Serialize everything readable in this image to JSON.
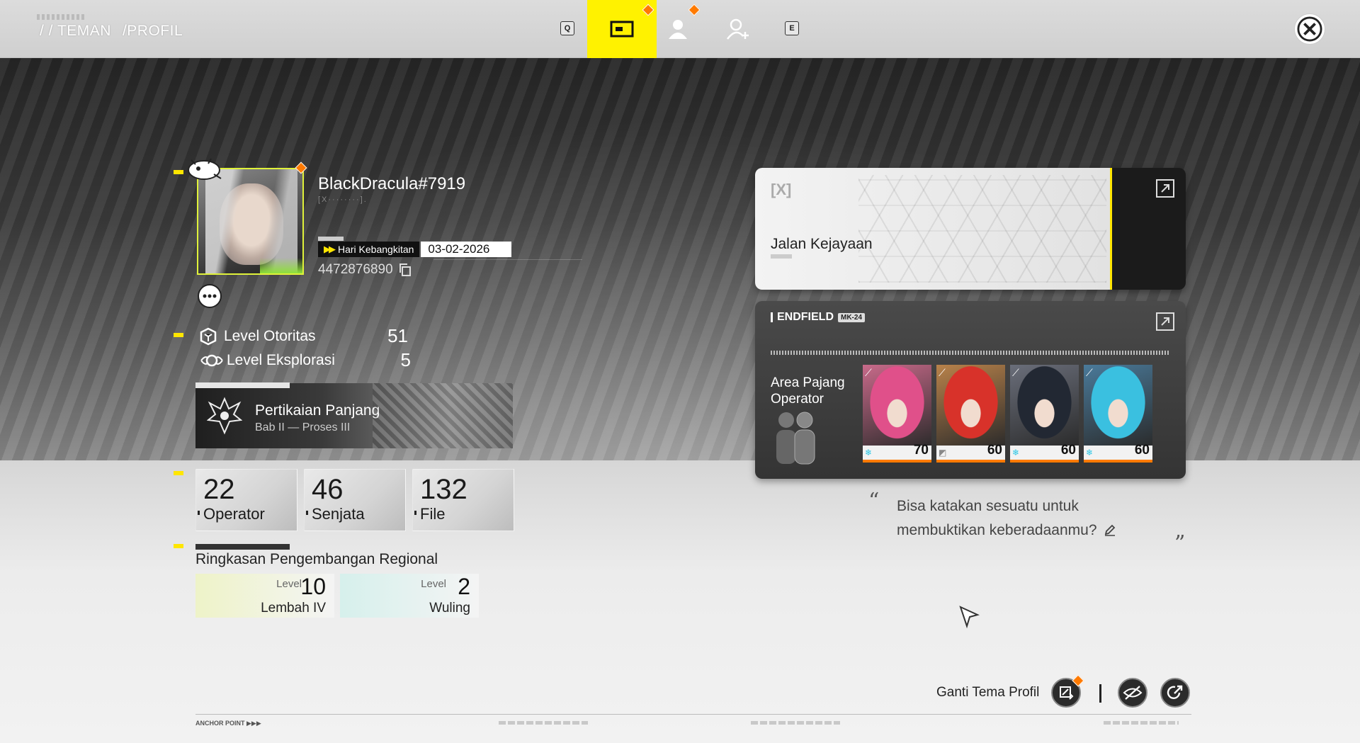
{
  "breadcrumb": {
    "prefix": "/ / TEMAN",
    "current": "/PROFIL"
  },
  "topbar": {
    "key_left": "Q",
    "key_right": "E",
    "tabs": [
      {
        "name": "profile-card",
        "active": true
      },
      {
        "name": "friends",
        "active": false
      },
      {
        "name": "add-friend",
        "active": false
      }
    ]
  },
  "profile": {
    "username": "BlackDracula#7919",
    "username_sub": "[X········].",
    "birthday_label": "Hari Kebangkitan",
    "birthday_date": "03-02-2026",
    "uid": "4472876890"
  },
  "stats": {
    "authority_label": "Level Otoritas",
    "authority_value": "51",
    "exploration_label": "Level Eksplorasi",
    "exploration_value": "5"
  },
  "story": {
    "title": "Pertikaian Panjang",
    "subtitle": "Bab II — Proses III"
  },
  "counts": [
    {
      "value": "22",
      "label": "Operator"
    },
    {
      "value": "46",
      "label": "Senjata"
    },
    {
      "value": "132",
      "label": "File"
    }
  ],
  "region": {
    "title": "Ringkasan Pengembangan Regional",
    "level_word": "Level",
    "items": [
      {
        "name": "Lembah IV",
        "level": "10",
        "color": "#eef3c8"
      },
      {
        "name": "Wuling",
        "level": "2",
        "color": "#d6f0ec"
      }
    ]
  },
  "pass_card": {
    "title": "Jalan Kejayaan"
  },
  "operator_card": {
    "brand": "ENDFIELD",
    "brand_pill": "MK-24",
    "area_line1": "Area Pajang",
    "area_line2": "Operator",
    "operators": [
      {
        "level": "70",
        "hair": "#e0508a",
        "bg": "#c86a8a"
      },
      {
        "level": "60",
        "hair": "#d8322a",
        "bg": "#b8824a"
      },
      {
        "level": "60",
        "hair": "#222833",
        "bg": "#6a6e7a"
      },
      {
        "level": "60",
        "hair": "#3ac0e0",
        "bg": "#4a7a9a"
      }
    ]
  },
  "quote": {
    "line1": "Bisa katakan sesuatu untuk",
    "line2": "membuktikan keberadaanmu?"
  },
  "footer": {
    "theme_label": "Ganti Tema Profil",
    "anchor_label": "ANCHOR POINT"
  },
  "colors": {
    "accent_yellow": "#fff200",
    "accent_orange": "#ff7a00"
  }
}
